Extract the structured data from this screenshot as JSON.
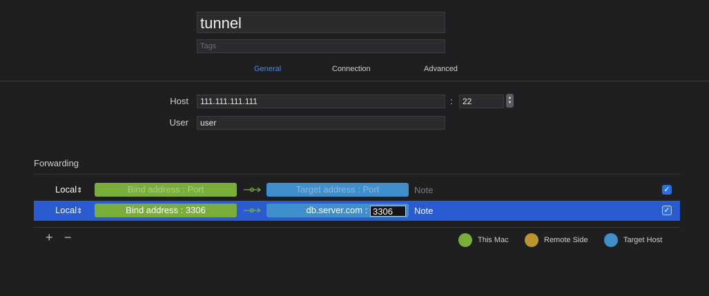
{
  "header": {
    "name_value": "tunnel",
    "tags_placeholder": "Tags"
  },
  "tabs": [
    {
      "label": "General",
      "active": true
    },
    {
      "label": "Connection",
      "active": false
    },
    {
      "label": "Advanced",
      "active": false
    }
  ],
  "general": {
    "host_label": "Host",
    "host_value": "111.111.111.111",
    "port_separator": ":",
    "port_value": "22",
    "user_label": "User",
    "user_value": "user"
  },
  "forwarding": {
    "title": "Forwarding",
    "rows": [
      {
        "type": "Local",
        "bind": "Bind address",
        "bind_sep": ":",
        "bind_port": "Port",
        "target": "Target address",
        "target_sep": ":",
        "target_port": "Port",
        "note": "Note",
        "checked": true,
        "selected": false
      },
      {
        "type": "Local",
        "bind": "Bind address",
        "bind_sep": ":",
        "bind_port": "3306",
        "target": "db.server.com",
        "target_sep": ":",
        "target_port": "3306",
        "note": "Note",
        "checked": true,
        "selected": true
      }
    ],
    "add_label": "+",
    "remove_label": "−"
  },
  "legend": [
    {
      "label": "This Mac",
      "color": "#79ae3a"
    },
    {
      "label": "Remote Side",
      "color": "#b8952d"
    },
    {
      "label": "Target Host",
      "color": "#3e8fcc"
    }
  ],
  "icons": {
    "updown": "⌃⌄",
    "check": "✓"
  }
}
